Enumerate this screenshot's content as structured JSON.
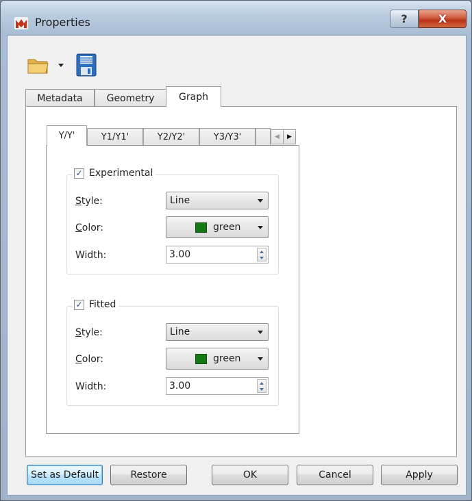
{
  "window": {
    "title": "Properties",
    "help_glyph": "?",
    "close_glyph": "X"
  },
  "toolbar": {
    "open_icon": "folder-icon",
    "save_icon": "floppy-disk-icon"
  },
  "tabs": [
    {
      "label": "Metadata",
      "active": false
    },
    {
      "label": "Geometry",
      "active": false
    },
    {
      "label": "Graph",
      "active": true
    }
  ],
  "subtabs": [
    {
      "label": "Y/Y'",
      "active": true
    },
    {
      "label": "Y1/Y1'",
      "active": false
    },
    {
      "label": "Y2/Y2'",
      "active": false
    },
    {
      "label": "Y3/Y3'",
      "active": false
    }
  ],
  "groups": {
    "experimental": {
      "title": "Experimental",
      "checked": true,
      "style_label": "Style:",
      "style_value": "Line",
      "color_label": "Color:",
      "color_value": "green",
      "color_hex": "#137a13",
      "width_label": "Width:",
      "width_value": "3.00"
    },
    "fitted": {
      "title": "Fitted",
      "checked": true,
      "style_label": "Style:",
      "style_value": "Line",
      "color_label": "Color:",
      "color_value": "green",
      "color_hex": "#137a13",
      "width_label": "Width:",
      "width_value": "3.00"
    }
  },
  "buttons": {
    "set_default": "Set as Default",
    "restore": "Restore",
    "ok": "OK",
    "cancel": "Cancel",
    "apply": "Apply"
  }
}
